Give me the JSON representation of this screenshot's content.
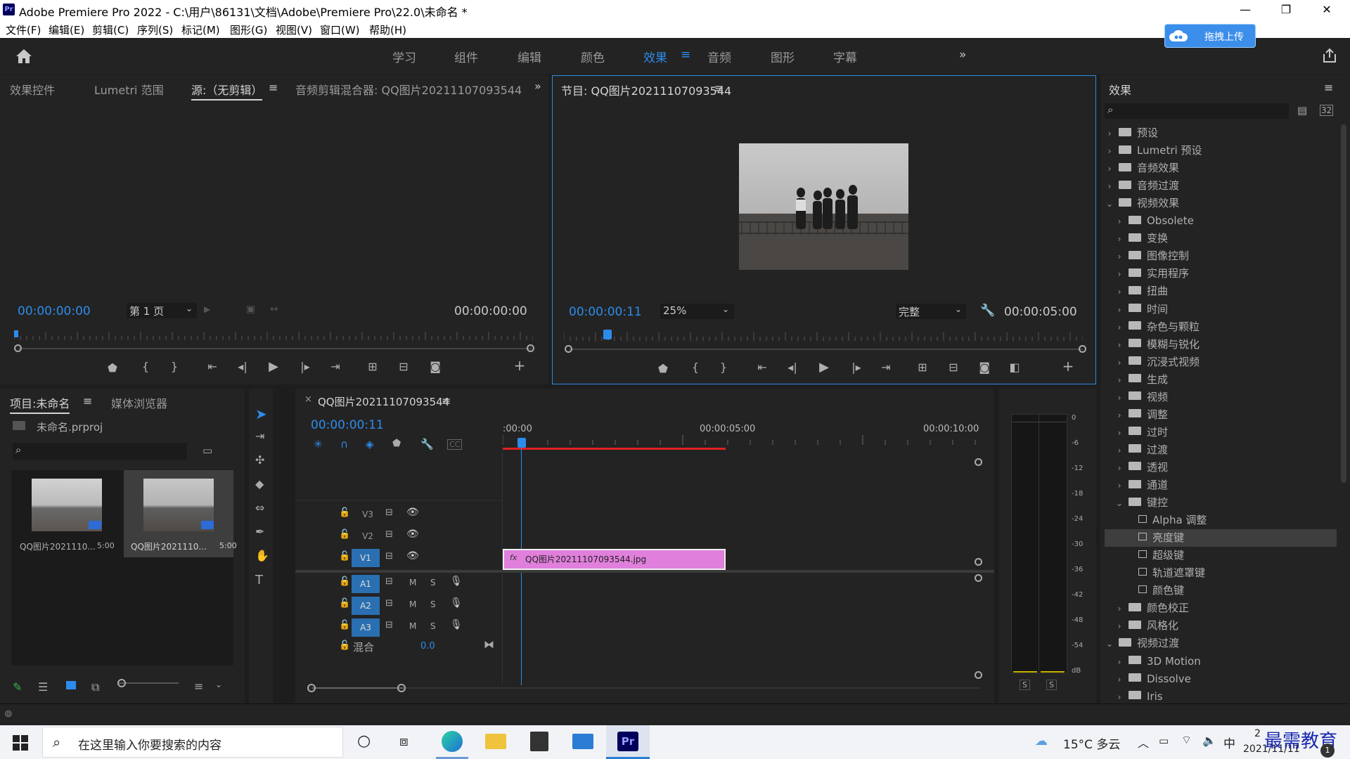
{
  "window": {
    "title": "Adobe Premiere Pro 2022 - C:\\用户\\86131\\文档\\Adobe\\Premiere Pro\\22.0\\未命名 *",
    "app_icon": "Pr",
    "minimize": "—",
    "restore": "❐",
    "close": "✕"
  },
  "menu": [
    "文件(F)",
    "编辑(E)",
    "剪辑(C)",
    "序列(S)",
    "标记(M)",
    "图形(G)",
    "视图(V)",
    "窗口(W)",
    "帮助(H)"
  ],
  "workspaces": [
    "学习",
    "组件",
    "编辑",
    "颜色",
    "效果",
    "音频",
    "图形",
    "字幕"
  ],
  "upload_button": "拖拽上传",
  "source_panel": {
    "tabs": [
      "效果控件",
      "Lumetri 范围",
      "源:（无剪辑）",
      "音频剪辑混合器: QQ图片20211107093544"
    ],
    "timecode_in": "00:00:00:00",
    "page_select": "第 1 页",
    "timecode_out": "00:00:00:00"
  },
  "program_panel": {
    "title": "节目: QQ图片20211107093544",
    "timecode": "00:00:00:11",
    "zoom": "25%",
    "quality": "完整",
    "duration": "00:00:05:00"
  },
  "project_panel": {
    "tabs": [
      "项目:未命名",
      "媒体浏览器"
    ],
    "file": "未命名.prproj",
    "items": [
      {
        "name": "QQ图片2021110...",
        "duration": "5:00"
      },
      {
        "name": "QQ图片2021110...",
        "duration": "5:00"
      }
    ]
  },
  "timeline": {
    "tab": "QQ图片20211107093544",
    "close": "×",
    "timecode": "00:00:00:11",
    "ruler": [
      ":00:00",
      "00:00:05:00",
      "00:00:10:00"
    ],
    "video_tracks": [
      "V3",
      "V2",
      "V1"
    ],
    "audio_tracks": [
      "A1",
      "A2",
      "A3"
    ],
    "mix_label": "混合",
    "mix_value": "0.0",
    "clip_label": "QQ图片20211107093544.jpg",
    "clip_fx": "fx",
    "m": "M",
    "s": "S"
  },
  "meter": {
    "scale": [
      "0",
      "-6",
      "-12",
      "-18",
      "-24",
      "-30",
      "-36",
      "-42",
      "-48",
      "-54",
      "dB"
    ],
    "solo": [
      "S",
      "S"
    ]
  },
  "effects_panel": {
    "title": "效果",
    "tree": [
      {
        "label": "预设",
        "level": 0,
        "open": false,
        "icon": "folder-star"
      },
      {
        "label": "Lumetri 预设",
        "level": 0,
        "open": false,
        "icon": "folder-star"
      },
      {
        "label": "音频效果",
        "level": 0,
        "open": false,
        "icon": "folder"
      },
      {
        "label": "音频过渡",
        "level": 0,
        "open": false,
        "icon": "folder"
      },
      {
        "label": "视频效果",
        "level": 0,
        "open": true,
        "icon": "folder"
      },
      {
        "label": "Obsolete",
        "level": 1,
        "open": false,
        "icon": "folder"
      },
      {
        "label": "变换",
        "level": 1,
        "open": false,
        "icon": "folder"
      },
      {
        "label": "图像控制",
        "level": 1,
        "open": false,
        "icon": "folder"
      },
      {
        "label": "实用程序",
        "level": 1,
        "open": false,
        "icon": "folder"
      },
      {
        "label": "扭曲",
        "level": 1,
        "open": false,
        "icon": "folder"
      },
      {
        "label": "时间",
        "level": 1,
        "open": false,
        "icon": "folder"
      },
      {
        "label": "杂色与颗粒",
        "level": 1,
        "open": false,
        "icon": "folder"
      },
      {
        "label": "模糊与锐化",
        "level": 1,
        "open": false,
        "icon": "folder"
      },
      {
        "label": "沉浸式视频",
        "level": 1,
        "open": false,
        "icon": "folder"
      },
      {
        "label": "生成",
        "level": 1,
        "open": false,
        "icon": "folder"
      },
      {
        "label": "视频",
        "level": 1,
        "open": false,
        "icon": "folder"
      },
      {
        "label": "调整",
        "level": 1,
        "open": false,
        "icon": "folder"
      },
      {
        "label": "过时",
        "level": 1,
        "open": false,
        "icon": "folder"
      },
      {
        "label": "过渡",
        "level": 1,
        "open": false,
        "icon": "folder"
      },
      {
        "label": "透视",
        "level": 1,
        "open": false,
        "icon": "folder"
      },
      {
        "label": "通道",
        "level": 1,
        "open": false,
        "icon": "folder"
      },
      {
        "label": "键控",
        "level": 1,
        "open": true,
        "icon": "folder"
      },
      {
        "label": "Alpha 调整",
        "level": 2,
        "icon": "effect"
      },
      {
        "label": "亮度键",
        "level": 2,
        "icon": "effect",
        "selected": true
      },
      {
        "label": "超级键",
        "level": 2,
        "icon": "effect"
      },
      {
        "label": "轨道遮罩键",
        "level": 2,
        "icon": "effect"
      },
      {
        "label": "颜色键",
        "level": 2,
        "icon": "effect"
      },
      {
        "label": "颜色校正",
        "level": 1,
        "open": false,
        "icon": "folder"
      },
      {
        "label": "风格化",
        "level": 1,
        "open": false,
        "icon": "folder"
      },
      {
        "label": "视频过渡",
        "level": 0,
        "open": true,
        "icon": "folder"
      },
      {
        "label": "3D Motion",
        "level": 1,
        "open": false,
        "icon": "folder"
      },
      {
        "label": "Dissolve",
        "level": 1,
        "open": false,
        "icon": "folder"
      },
      {
        "label": "Iris",
        "level": 1,
        "open": false,
        "icon": "folder"
      }
    ]
  },
  "taskbar": {
    "search_placeholder": "在这里输入你要搜索的内容",
    "weather": "15°C 多云",
    "ime": "中",
    "time": "2",
    "date": "2021/11/11",
    "watermark": "最需教育"
  },
  "colors": {
    "accent": "#2d8ceb",
    "clip": "#e07fdc",
    "playhead": "#2d8ceb",
    "workarea": "#e02020"
  }
}
